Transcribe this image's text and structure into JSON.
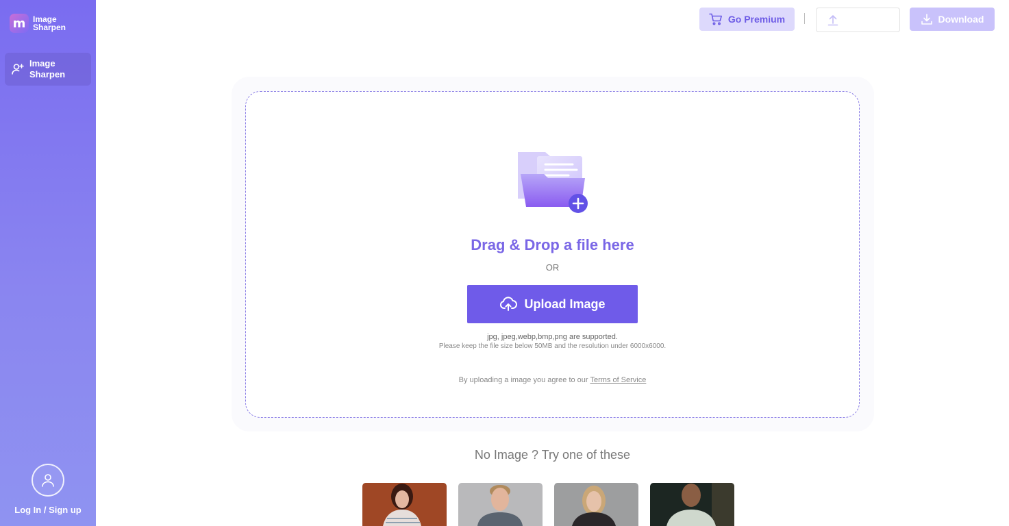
{
  "app": {
    "logo_line1": "Image",
    "logo_line2": "Sharpen",
    "logo_mark": "m"
  },
  "sidebar": {
    "items": [
      {
        "line1": "Image",
        "line2": "Sharpen",
        "icon": "user-plus-icon"
      }
    ],
    "login_label": "Log In / Sign up"
  },
  "topbar": {
    "premium_label": "Go Premium",
    "download_label": "Download"
  },
  "upload": {
    "title": "Drag & Drop a file here",
    "or": "OR",
    "button_label": "Upload Image",
    "formats": "jpg, jpeg,webp,bmp,png are supported.",
    "limits": "Please keep the file size below 50MB and the resolution under 6000x6000.",
    "tos_prefix": "By uploading a image you agree to our ",
    "tos_link": "Terms of Service"
  },
  "samples": {
    "heading": "No Image ? Try one of these",
    "items": [
      {
        "name": "sample-woman-red"
      },
      {
        "name": "sample-man-gray"
      },
      {
        "name": "sample-woman-blonde"
      },
      {
        "name": "sample-man-dark"
      }
    ]
  },
  "colors": {
    "accent": "#6f5be9",
    "sidebar_top": "#7a6cf0",
    "sidebar_bottom": "#8f93f1"
  }
}
